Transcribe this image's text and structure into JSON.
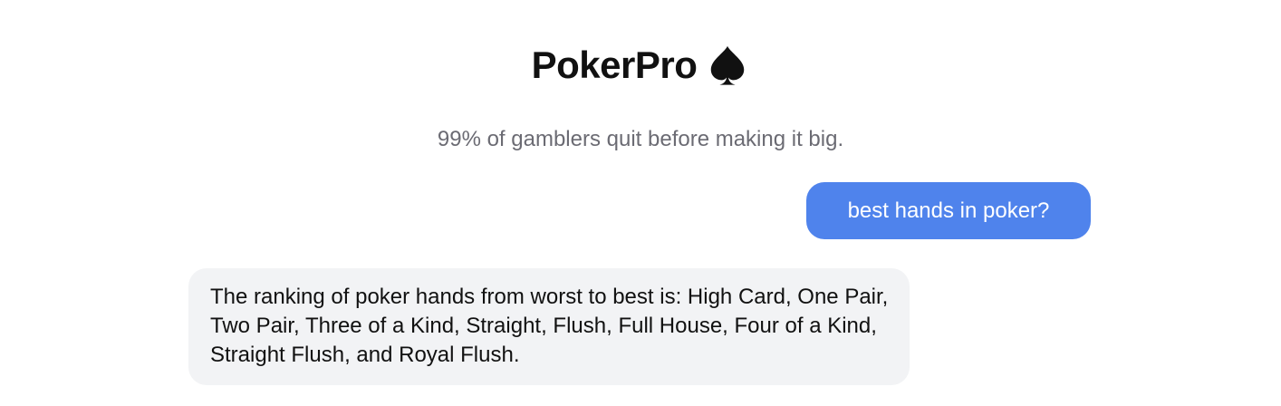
{
  "header": {
    "title": "PokerPro",
    "title_icon": "spade-icon",
    "subtitle": "99% of gamblers quit before making it big."
  },
  "chat": {
    "messages": [
      {
        "role": "user",
        "text": "best hands in poker?"
      },
      {
        "role": "assistant",
        "text": "The ranking of poker hands from worst to best is: High Card, One Pair, Two Pair, Three of a Kind, Straight, Flush, Full House, Four of a Kind, Straight Flush, and Royal Flush."
      }
    ]
  },
  "colors": {
    "user_bubble": "#4f83ec",
    "assistant_bubble": "#f2f3f5",
    "subtitle_text": "#6b6b73"
  }
}
